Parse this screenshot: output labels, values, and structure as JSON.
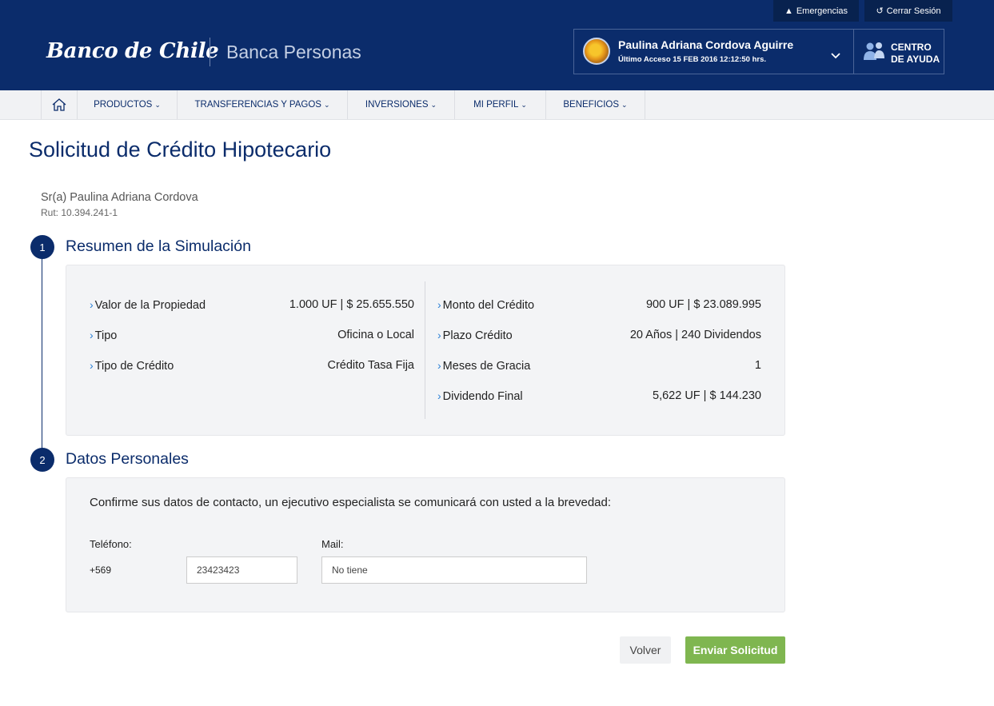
{
  "header": {
    "top_links": {
      "emergencias": "Emergencias",
      "cerrar_sesion": "Cerrar Sesión"
    },
    "logo_text": "Banco de Chile",
    "section": "Banca Personas",
    "user": {
      "name": "Paulina Adriana Cordova Aguirre",
      "last_access": "Último Acceso 15 FEB 2016 12:12:50 hrs."
    },
    "help": {
      "line1": "CENTRO",
      "line2": "DE AYUDA"
    }
  },
  "nav": {
    "items": [
      {
        "label": "PRODUCTOS"
      },
      {
        "label": "TRANSFERENCIAS Y PAGOS"
      },
      {
        "label": "INVERSIONES"
      },
      {
        "label": "MI PERFIL"
      },
      {
        "label": "BENEFICIOS"
      }
    ]
  },
  "page": {
    "title": "Solicitud de Crédito Hipotecario",
    "client_name": "Sr(a) Paulina Adriana Cordova",
    "client_rut": "Rut: 10.394.241-1"
  },
  "steps": [
    {
      "number": "1",
      "title": "Resumen de la Simulación"
    },
    {
      "number": "2",
      "title": "Datos Personales"
    }
  ],
  "summary": {
    "left": [
      {
        "label": "Valor de la Propiedad",
        "value": "1.000 UF | $ 25.655.550"
      },
      {
        "label": "Tipo",
        "value": "Oficina o Local"
      },
      {
        "label": "Tipo de Crédito",
        "value": "Crédito Tasa Fija"
      }
    ],
    "right": [
      {
        "label": "Monto del Crédito",
        "value": "900 UF | $ 23.089.995"
      },
      {
        "label": "Plazo Crédito",
        "value": "20 Años | 240 Dividendos"
      },
      {
        "label": "Meses de Gracia",
        "value": "1"
      },
      {
        "label": "Dividendo Final",
        "value": "5,622 UF | $ 144.230"
      }
    ]
  },
  "personal": {
    "confirm_text": "Confirme sus datos de contacto, un ejecutivo especialista se comunicará con usted a la brevedad:",
    "phone_label": "Teléfono:",
    "phone_prefix": "+569",
    "phone_value": "23423423",
    "mail_label": "Mail:",
    "mail_value": "No tiene"
  },
  "actions": {
    "back": "Volver",
    "submit": "Enviar Solicitud"
  },
  "colors": {
    "primary": "#0b2c6b",
    "accent_arrow": "#2a7fd4",
    "submit": "#7fb650"
  }
}
